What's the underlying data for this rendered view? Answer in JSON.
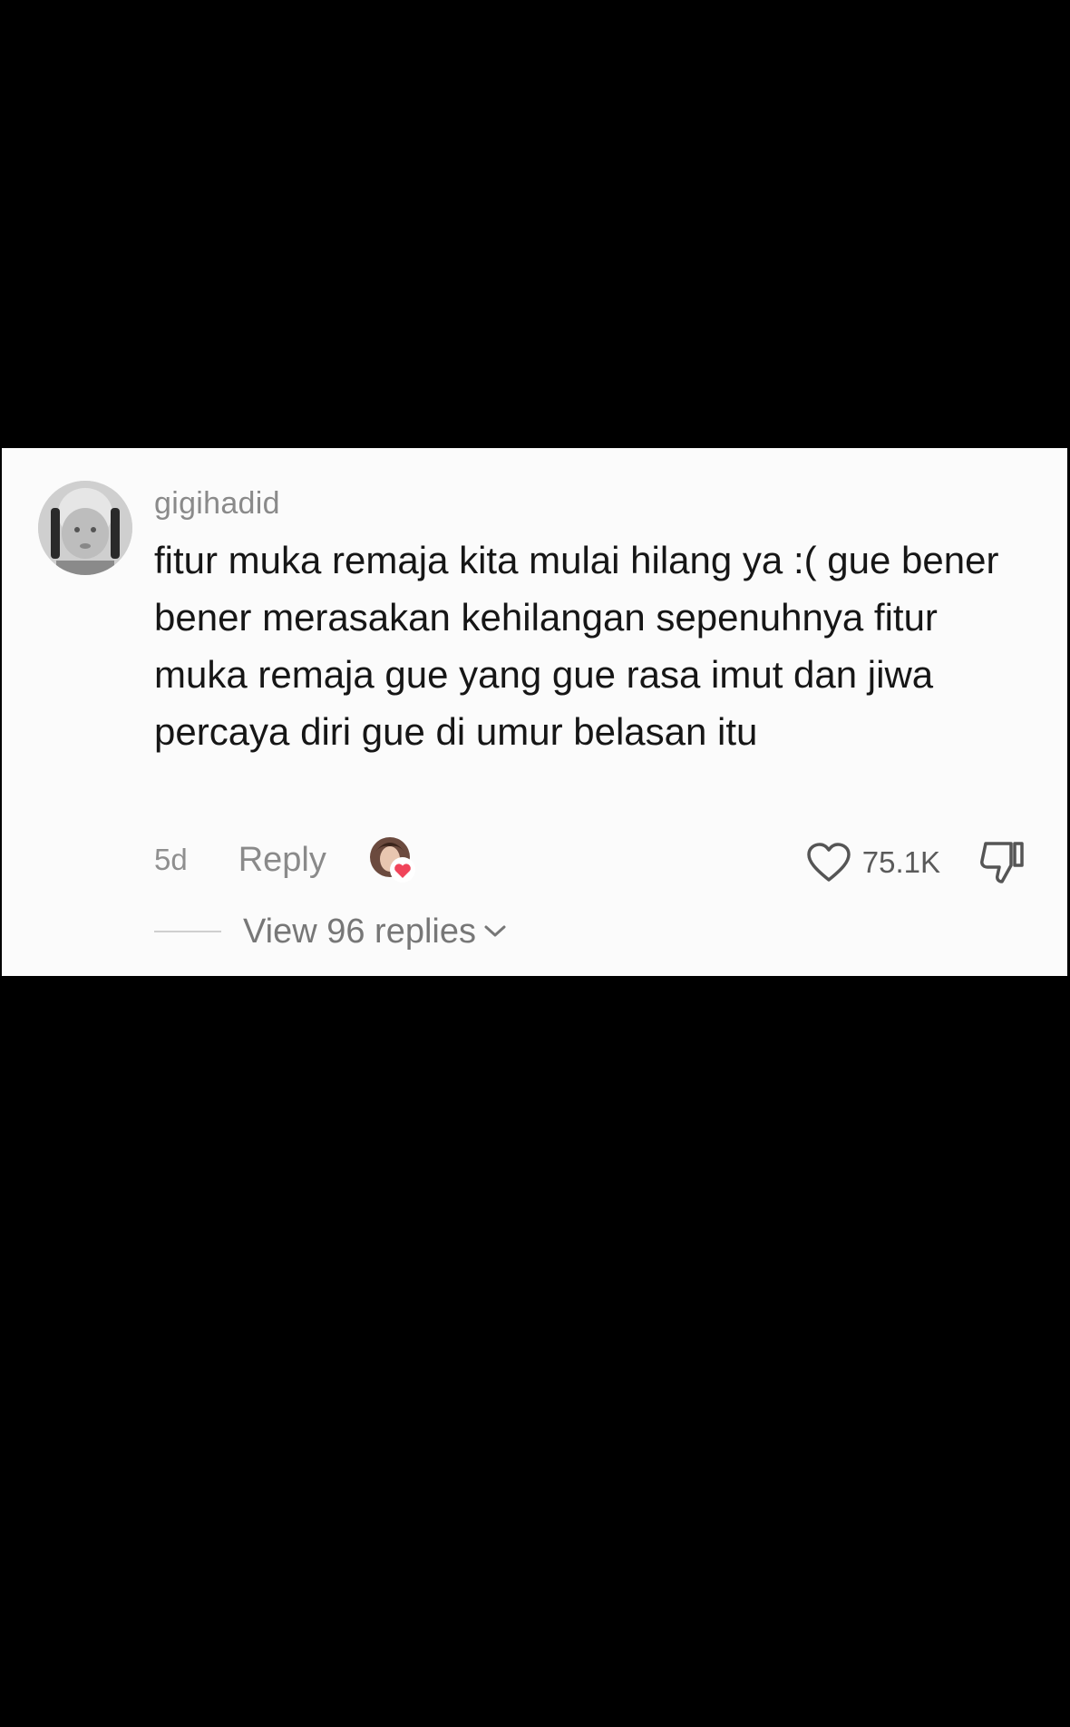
{
  "comment": {
    "username": "gigihadid",
    "text": "fitur muka remaja kita mulai hilang ya :( gue bener bener merasakan kehilangan sepenuhnya fitur muka remaja gue yang gue rasa imut dan jiwa percaya diri gue di umur belasan itu",
    "time_ago": "5d",
    "reply_label": "Reply",
    "like_count": "75.1K",
    "view_replies_label": "View 96 replies"
  },
  "icons": {
    "avatar": "user-avatar",
    "creator_liked": "creator-avatar-heart-icon",
    "like": "heart-outline-icon",
    "dislike": "thumbs-down-icon",
    "expand": "chevron-down-icon"
  },
  "colors": {
    "card_background": "#fbfbfb",
    "page_background": "#000000",
    "heart_badge": "#f0445a"
  }
}
